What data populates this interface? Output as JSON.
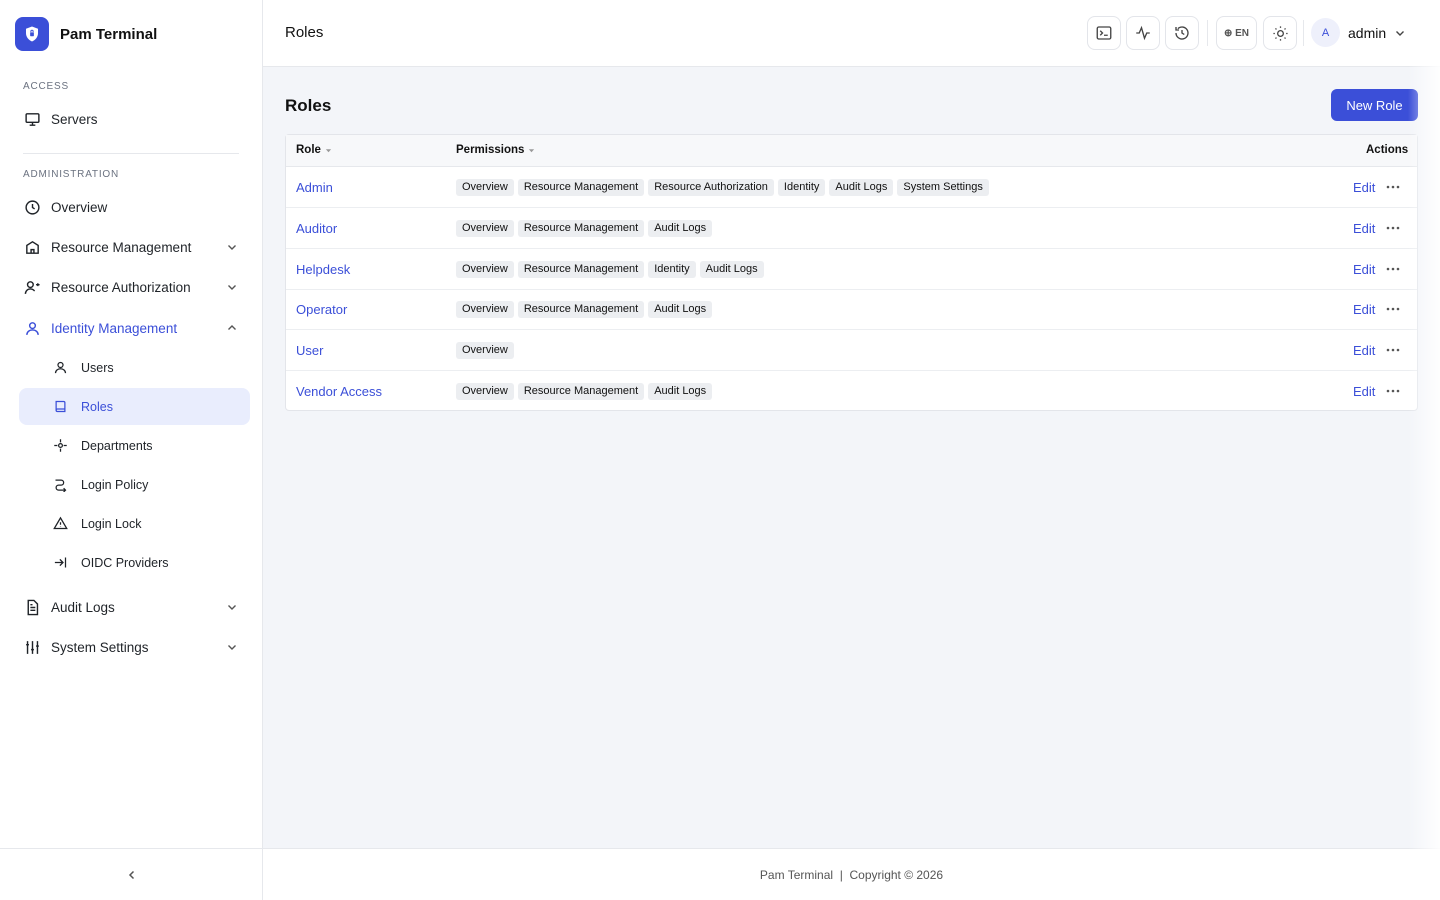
{
  "app": {
    "name": "Pam Terminal"
  },
  "sidebar": {
    "access_label": "ACCESS",
    "admin_label": "ADMINISTRATION",
    "servers": "Servers",
    "overview": "Overview",
    "resource_management": "Resource Management",
    "resource_authorization": "Resource Authorization",
    "identity_management": "Identity Management",
    "sub": {
      "users": "Users",
      "roles": "Roles",
      "departments": "Departments",
      "login_policy": "Login Policy",
      "login_lock": "Login Lock",
      "oidc_providers": "OIDC Providers"
    },
    "audit_logs": "Audit Logs",
    "system_settings": "System Settings"
  },
  "header": {
    "title": "Roles",
    "lang": "EN",
    "avatar_initial": "A",
    "username": "admin"
  },
  "main": {
    "title": "Roles",
    "new_button": "New Role",
    "columns": {
      "role": "Role",
      "permissions": "Permissions",
      "actions": "Actions"
    },
    "edit_label": "Edit",
    "rows": [
      {
        "role": "Admin",
        "permissions": [
          "Overview",
          "Resource Management",
          "Resource Authorization",
          "Identity",
          "Audit Logs",
          "System Settings"
        ]
      },
      {
        "role": "Auditor",
        "permissions": [
          "Overview",
          "Resource Management",
          "Audit Logs"
        ]
      },
      {
        "role": "Helpdesk",
        "permissions": [
          "Overview",
          "Resource Management",
          "Identity",
          "Audit Logs"
        ]
      },
      {
        "role": "Operator",
        "permissions": [
          "Overview",
          "Resource Management",
          "Audit Logs"
        ]
      },
      {
        "role": "User",
        "permissions": [
          "Overview"
        ]
      },
      {
        "role": "Vendor Access",
        "permissions": [
          "Overview",
          "Resource Management",
          "Audit Logs"
        ]
      }
    ]
  },
  "footer": {
    "text": "Pam Terminal  |  Copyright © 2026"
  },
  "colors": {
    "accent": "#3b4fd8",
    "active_bg": "#e9edfd",
    "page_bg": "#f3f5f9"
  }
}
